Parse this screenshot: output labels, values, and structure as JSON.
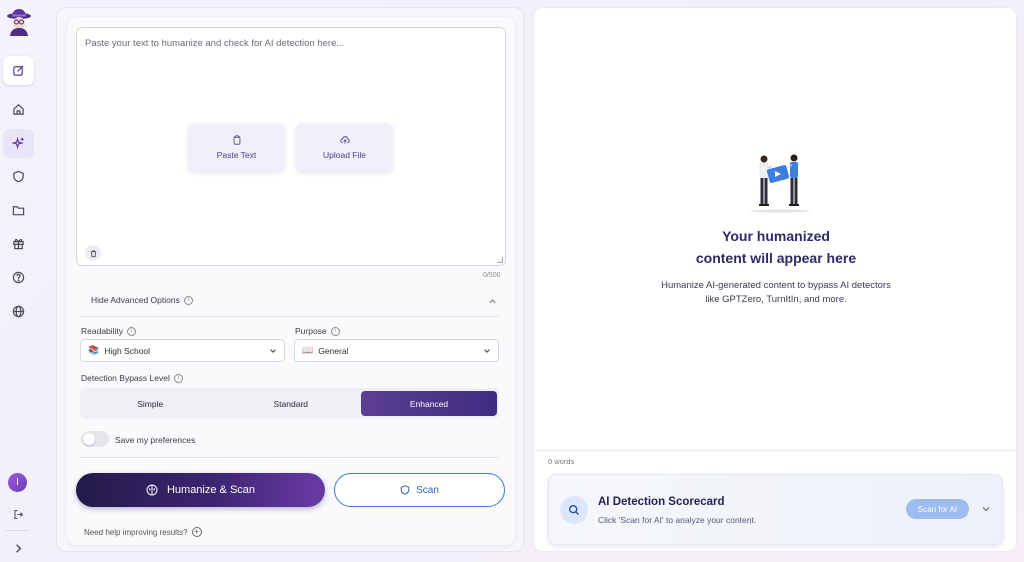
{
  "sidebar": {
    "logo": "detective-hat-logo",
    "items": [
      {
        "name": "new-icon"
      },
      {
        "name": "home-icon"
      },
      {
        "name": "sparkle-icon"
      },
      {
        "name": "shield-icon"
      },
      {
        "name": "folder-icon"
      },
      {
        "name": "gift-icon"
      },
      {
        "name": "help-icon"
      },
      {
        "name": "globe-icon"
      }
    ],
    "avatar_initial": "I",
    "logout_icon": "logout-icon",
    "expand_icon": "chevron-right-icon"
  },
  "editor": {
    "placeholder": "Paste your text to humanize and check for AI detection here...",
    "paste_label": "Paste Text",
    "upload_label": "Upload File",
    "char_count": "0/500"
  },
  "advanced": {
    "toggle_label": "Hide Advanced Options",
    "readability_label": "Readability",
    "readability_value": "High School",
    "readability_emoji": "📚",
    "purpose_label": "Purpose",
    "purpose_value": "General",
    "purpose_emoji": "📖",
    "bypass_label": "Detection Bypass Level",
    "levels": [
      "Simple",
      "Standard",
      "Enhanced"
    ],
    "active_level": "Enhanced",
    "save_prefs_label": "Save my preferences",
    "save_prefs_on": false
  },
  "actions": {
    "humanize_label": "Humanize & Scan",
    "scan_label": "Scan",
    "help_label": "Need help improving results?"
  },
  "output": {
    "title_line1": "Your humanized",
    "title_line2": "content will appear here",
    "description": "Humanize AI-generated content to bypass AI detectors like GPTZero, TurnItIn, and more.",
    "word_count": "0 words"
  },
  "scorecard": {
    "title": "AI Detection Scorecard",
    "subtitle": "Click 'Scan for AI' to analyze your content.",
    "button_label": "Scan for AI"
  },
  "colors": {
    "accent": "#5b3f94",
    "title": "#2e2a6b",
    "scan_blue": "#3b7bd4"
  }
}
